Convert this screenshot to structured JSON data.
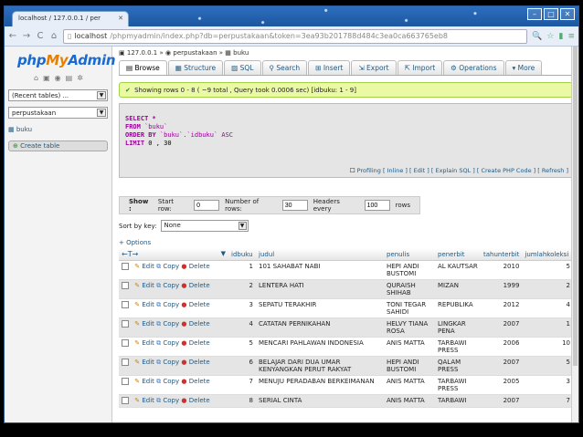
{
  "browser": {
    "tab_title": "localhost / 127.0.0.1 / per",
    "url_host": "localhost",
    "url_path": "/phpmyadmin/index.php?db=perpustakaan&token=3ea93b201788d484c3ea0ca663765eb8"
  },
  "left": {
    "logo_php": "php",
    "logo_my": "My",
    "logo_admin": "Admin",
    "recent_select": "(Recent tables) ...",
    "db_select": "perpustakaan",
    "table_item": "buku",
    "create_table": "Create table"
  },
  "crumb": {
    "server": "127.0.0.1",
    "db": "perpustakaan",
    "table": "buku"
  },
  "tabs": [
    "Browse",
    "Structure",
    "SQL",
    "Search",
    "Insert",
    "Export",
    "Import",
    "Operations",
    "More"
  ],
  "success": "Showing rows 0 - 8 ( ~9 total , Query took 0.0006 sec) [idbuku: 1 - 9]",
  "sql": {
    "line1": "SELECT *",
    "line2_kw": "FROM",
    "line2_val": "`buku`",
    "line3_kw": "ORDER BY",
    "line3_val": "`buku`.`idbuku` ASC",
    "line4_kw": "LIMIT",
    "line4_val": "0 , 30",
    "links": "Profiling [ Inline ] [ Edit ] [ Explain SQL ] [ Create PHP Code ] [ Refresh ]"
  },
  "navform": {
    "show": "Show :",
    "start_label": "Start row:",
    "start_value": "0",
    "rows_label": "Number of rows:",
    "rows_value": "30",
    "headers_label": "Headers every",
    "headers_value": "100",
    "rows_suffix": "rows"
  },
  "sort": {
    "label": "Sort by key:",
    "value": "None"
  },
  "options_label": "+ Options",
  "table": {
    "columns": [
      "idbuku",
      "judul",
      "penulis",
      "penerbit",
      "tahunterbit",
      "jumlahkoleksi"
    ],
    "edit": "Edit",
    "copy": "Copy",
    "delete": "Delete",
    "rows": [
      {
        "idbuku": "1",
        "judul": "101 SAHABAT NABI",
        "penulis": "HEPI ANDI BUSTOMI",
        "penerbit": "AL KAUTSAR",
        "tahunterbit": "2010",
        "jumlahkoleksi": "5"
      },
      {
        "idbuku": "2",
        "judul": "LENTERA HATI",
        "penulis": "QURAISH SHIHAB",
        "penerbit": "MIZAN",
        "tahunterbit": "1999",
        "jumlahkoleksi": "2"
      },
      {
        "idbuku": "3",
        "judul": "SEPATU TERAKHIR",
        "penulis": "TONI TEGAR SAHIDI",
        "penerbit": "REPUBLIKA",
        "tahunterbit": "2012",
        "jumlahkoleksi": "4"
      },
      {
        "idbuku": "4",
        "judul": "CATATAN PERNIKAHAN",
        "penulis": "HELVY TIANA ROSA",
        "penerbit": "LINGKAR PENA",
        "tahunterbit": "2007",
        "jumlahkoleksi": "1"
      },
      {
        "idbuku": "5",
        "judul": "MENCARI PAHLAWAN INDONESIA",
        "penulis": "ANIS MATTA",
        "penerbit": "TARBAWI PRESS",
        "tahunterbit": "2006",
        "jumlahkoleksi": "10"
      },
      {
        "idbuku": "6",
        "judul": "BELAJAR DARI DUA UMAR KENYANGKAN PERUT RAKYAT",
        "penulis": "HEPI ANDI BUSTOMI",
        "penerbit": "QALAM PRESS",
        "tahunterbit": "2007",
        "jumlahkoleksi": "5"
      },
      {
        "idbuku": "7",
        "judul": "MENUJU PERADABAN BERKEIMANAN",
        "penulis": "ANIS MATTA",
        "penerbit": "TARBAWI PRESS",
        "tahunterbit": "2005",
        "jumlahkoleksi": "3"
      },
      {
        "idbuku": "8",
        "judul": "SERIAL CINTA",
        "penulis": "ANIS MATTA",
        "penerbit": "TARBAWI",
        "tahunterbit": "2007",
        "jumlahkoleksi": "7"
      }
    ]
  }
}
